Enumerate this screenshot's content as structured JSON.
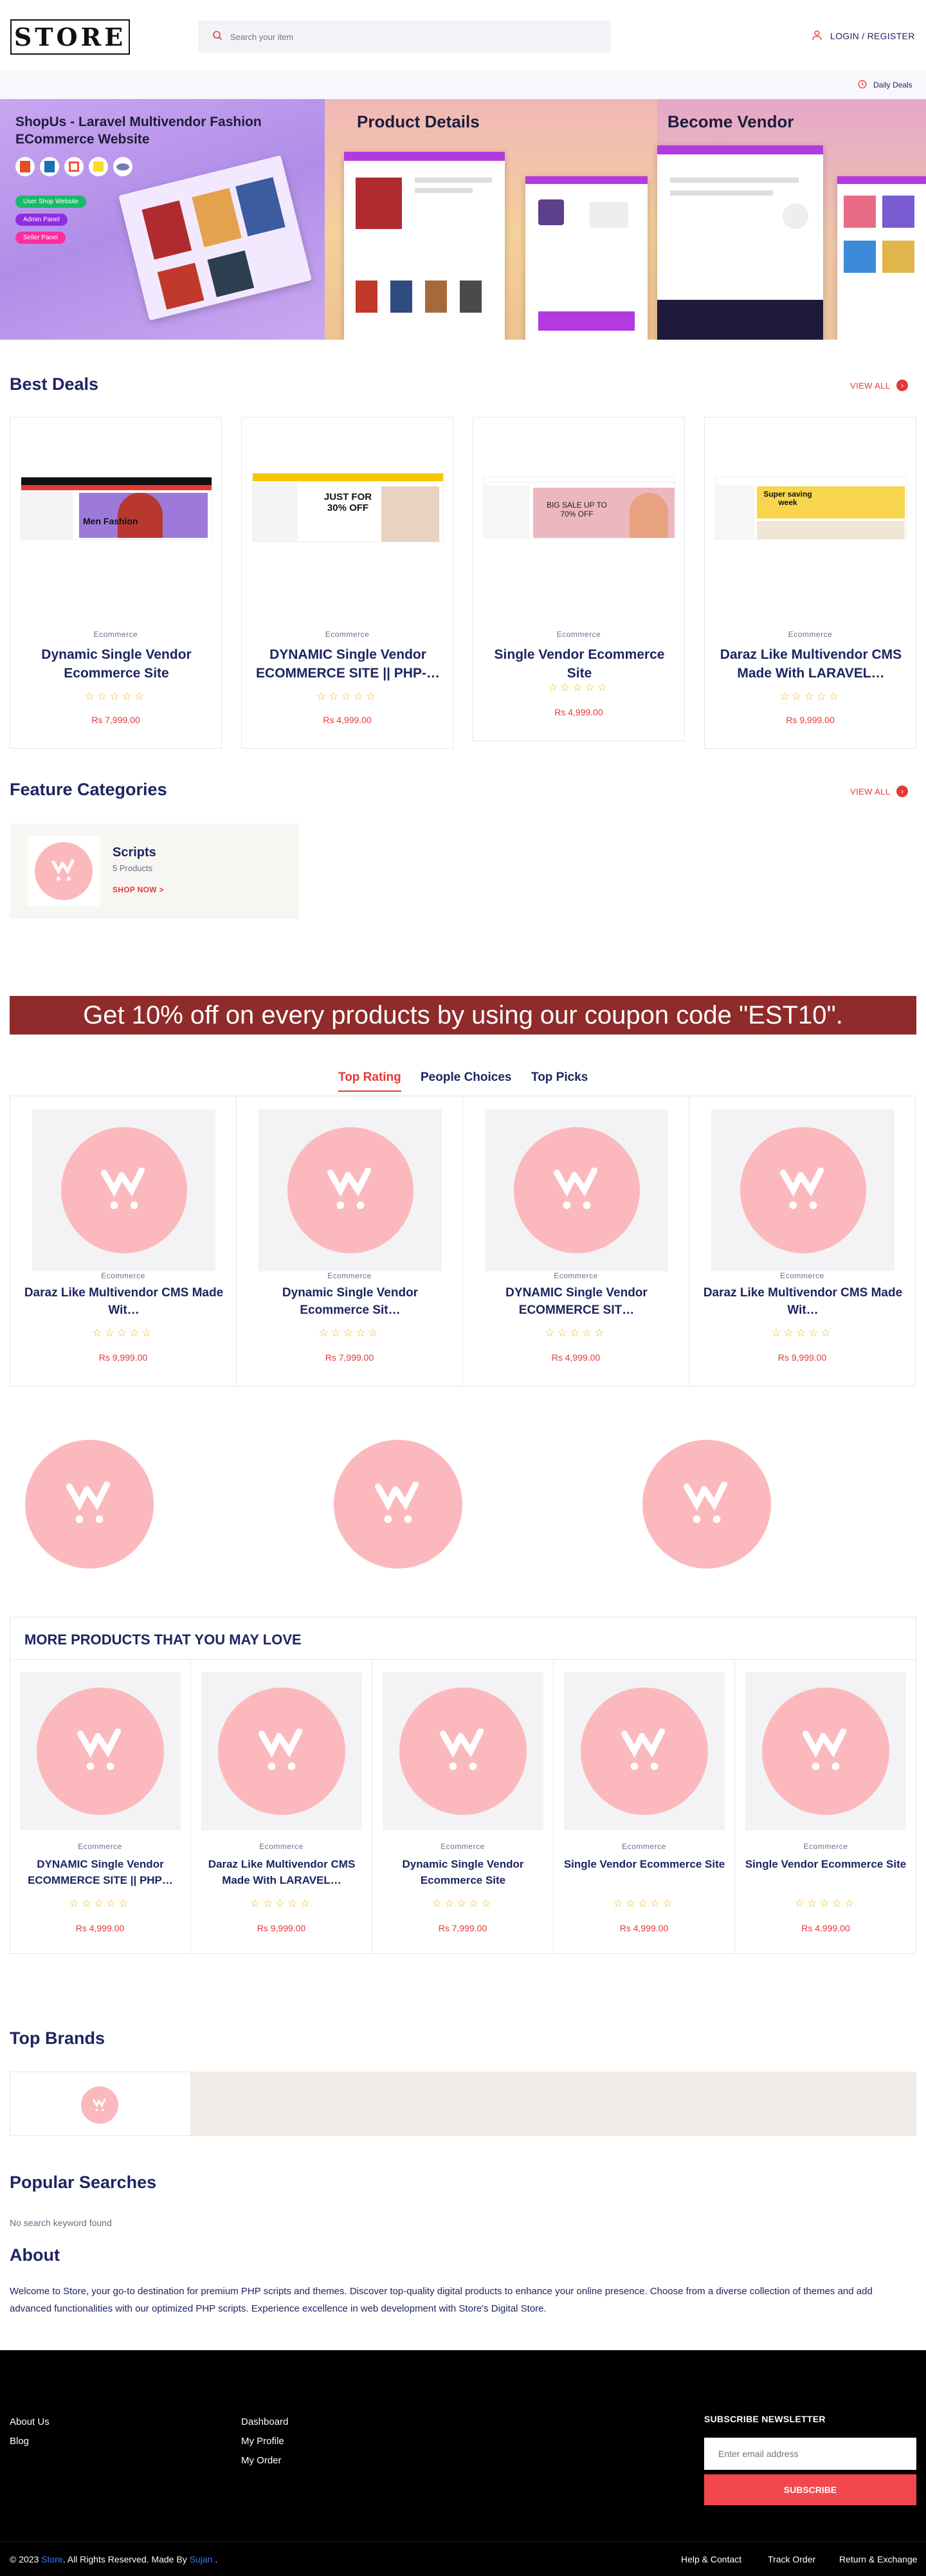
{
  "header": {
    "logo": "STORE",
    "search_placeholder": "Search your item",
    "login_label": "LOGIN / REGISTER",
    "daily_deals_label": "Daily Deals"
  },
  "banner": {
    "panel1_title": "ShopUs - Laravel Multivendor Fashion ECommerce Website",
    "panel1_badges": [
      "User Shop Website",
      "Admin Panel",
      "Seller Panel"
    ],
    "panel1_tech": [
      "HTML5",
      "CSS3",
      "Laravel",
      "JS",
      "PHP"
    ],
    "panel2_title": "Product Details",
    "panel3_title": "Become Vendor"
  },
  "best_deals": {
    "title": "Best Deals",
    "view_all": "VIEW ALL",
    "products": [
      {
        "category": "Ecommerce",
        "title": "Dynamic Single Vendor Ecommerce Site",
        "price": "Rs 7,999.00",
        "rating": 0,
        "thumb_text": "Men Fashion"
      },
      {
        "category": "Ecommerce",
        "title": "DYNAMIC Single Vendor ECOMMERCE SITE || PHP-…",
        "price": "Rs 4,999.00",
        "rating": 0,
        "thumb_text": "JUST FOR 30% OFF"
      },
      {
        "category": "Ecommerce",
        "title": "Single Vendor Ecommerce Site",
        "price": "Rs 4,999.00",
        "rating": 0,
        "thumb_text": "BIG SALE UP TO 70% OFF"
      },
      {
        "category": "Ecommerce",
        "title": "Daraz Like Multivendor CMS Made With LARAVEL…",
        "price": "Rs 9,999.00",
        "rating": 0,
        "thumb_text": "Super saving week"
      }
    ]
  },
  "feature_categories": {
    "title": "Feature Categories",
    "view_all": "VIEW ALL",
    "items": [
      {
        "name": "Scripts",
        "count": "5 Products",
        "cta": "SHOP NOW >"
      }
    ]
  },
  "coupon": {
    "text": "Get 10% off on every products by using our coupon code \"EST10\"."
  },
  "tabs": {
    "items": [
      "Top Rating",
      "People Choices",
      "Top Picks"
    ],
    "active": "Top Rating",
    "products": [
      {
        "category": "Ecommerce",
        "title": "Daraz Like Multivendor CMS Made Wit…",
        "price": "Rs 9,999.00",
        "rating": 0
      },
      {
        "category": "Ecommerce",
        "title": "Dynamic Single Vendor Ecommerce Sit…",
        "price": "Rs 7,999.00",
        "rating": 0
      },
      {
        "category": "Ecommerce",
        "title": "DYNAMIC Single Vendor ECOMMERCE SIT…",
        "price": "Rs 4,999.00",
        "rating": 0
      },
      {
        "category": "Ecommerce",
        "title": "Daraz Like Multivendor CMS Made Wit…",
        "price": "Rs 9,999.00",
        "rating": 0
      }
    ]
  },
  "more_products": {
    "title": "MORE PRODUCTS THAT YOU MAY LOVE",
    "products": [
      {
        "category": "Ecommerce",
        "title": "DYNAMIC Single Vendor ECOMMERCE SITE || PHP…",
        "price": "Rs 4,999.00",
        "rating": 0
      },
      {
        "category": "Ecommerce",
        "title": "Daraz Like Multivendor CMS Made With LARAVEL…",
        "price": "Rs 9,999.00",
        "rating": 0
      },
      {
        "category": "Ecommerce",
        "title": "Dynamic Single Vendor Ecommerce Site",
        "price": "Rs 7,999.00",
        "rating": 0
      },
      {
        "category": "Ecommerce",
        "title": "Single Vendor Ecommerce Site",
        "price": "Rs 4,999.00",
        "rating": 0
      },
      {
        "category": "Ecommerce",
        "title": "Single Vendor Ecommerce Site",
        "price": "Rs 4,999.00",
        "rating": 0
      }
    ]
  },
  "top_brands": {
    "title": "Top Brands"
  },
  "popular_searches": {
    "title": "Popular Searches",
    "empty_text": "No search keyword found"
  },
  "about": {
    "title": "About",
    "text": "Welcome to Store, your go-to destination for premium PHP scripts and themes. Discover top-quality digital products to enhance your online presence. Choose from a diverse collection of themes and add advanced functionalities with our optimized PHP scripts. Experience excellence in web development with Store's Digital Store."
  },
  "footer": {
    "col1": [
      "About Us",
      "Blog"
    ],
    "col2": [
      "Dashboard",
      "My Profile",
      "My Order"
    ],
    "newsletter_title": "SUBSCRIBE NEWSLETTER",
    "email_placeholder": "Enter email address",
    "subscribe_label": "SUBSCRIBE",
    "copyright_prefix": "© 2023 ",
    "copyright_brand": "Store",
    "copyright_mid": ". All Rights Reserved. Made By ",
    "copyright_author": "Sujan",
    "copyright_suffix": " .",
    "bottom_links": [
      "Help & Contact",
      "Track Order",
      "Return & Exchange"
    ]
  },
  "colors": {
    "accent": "#e53935",
    "navy": "#1d2560",
    "coupon_bg": "#8f2b2a",
    "placeholder_pink": "#fcb9bd"
  }
}
